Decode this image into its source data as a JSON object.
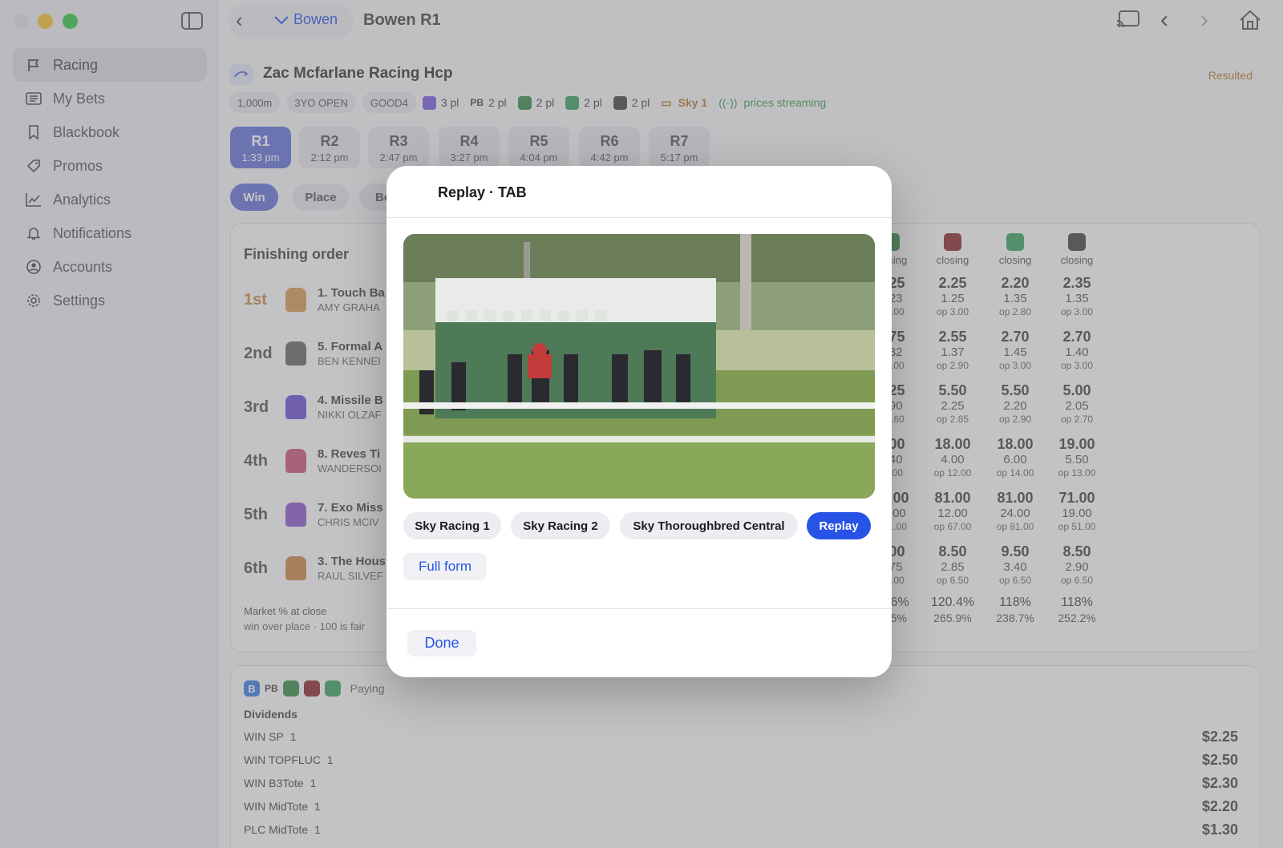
{
  "header": {
    "back_label": "Bowen",
    "title": "Bowen R1"
  },
  "sidebar": {
    "items": [
      {
        "label": "Racing",
        "icon": "flag-icon"
      },
      {
        "label": "My Bets",
        "icon": "list-icon"
      },
      {
        "label": "Blackbook",
        "icon": "bookmark-icon"
      },
      {
        "label": "Promos",
        "icon": "tag-icon"
      },
      {
        "label": "Analytics",
        "icon": "chart-icon"
      },
      {
        "label": "Notifications",
        "icon": "bell-icon"
      },
      {
        "label": "Accounts",
        "icon": "person-icon"
      },
      {
        "label": "Settings",
        "icon": "gear-icon"
      }
    ]
  },
  "race": {
    "name": "Zac Mcfarlane Racing Hcp",
    "status": "Resulted",
    "distance": "1,000m",
    "class": "3YO OPEN",
    "track": "GOOD4",
    "places": [
      "3 pl",
      "2 pl",
      "2 pl",
      "2 pl",
      "2 pl"
    ],
    "bookie_abbr": "PB",
    "channel": "Sky 1",
    "streaming": "prices streaming"
  },
  "race_tabs": [
    {
      "r": "R1",
      "t": "1:33 pm"
    },
    {
      "r": "R2",
      "t": "2:12 pm"
    },
    {
      "r": "R3",
      "t": "2:47 pm"
    },
    {
      "r": "R4",
      "t": "3:27 pm"
    },
    {
      "r": "R5",
      "t": "4:04 pm"
    },
    {
      "r": "R6",
      "t": "4:42 pm"
    },
    {
      "r": "R7",
      "t": "5:17 pm"
    }
  ],
  "bet_types": [
    "Win",
    "Place",
    "Bo"
  ],
  "finishing": {
    "title": "Finishing order",
    "rows": [
      {
        "pos": "1st",
        "name": "1. Touch Ba",
        "jockey": "AMY GRAHA",
        "silk": "#d89a52"
      },
      {
        "pos": "2nd",
        "name": "5. Formal A",
        "jockey": "BEN KENNEI",
        "silk": "#666666"
      },
      {
        "pos": "3rd",
        "name": "4. Missile B",
        "jockey": "NIKKI OLZAF",
        "silk": "#6b4fd1"
      },
      {
        "pos": "4th",
        "name": "8. Reves Ti",
        "jockey": "WANDERSOI",
        "silk": "#c8557a"
      },
      {
        "pos": "5th",
        "name": "7. Exo Miss",
        "jockey": "CHRIS MCIV",
        "silk": "#8a58c9"
      },
      {
        "pos": "6th",
        "name": "3. The Hous",
        "jockey": "RAUL SILVEF",
        "silk": "#c98846"
      }
    ],
    "market_title": "Market % at close",
    "market_sub": "win over place · 100 is fair"
  },
  "odds": {
    "header": "closing",
    "columns": [
      {
        "icon_color": "#3a8a4a",
        "icon": "shield-icon",
        "rows": [
          [
            "2.25",
            "1.23",
            "p 3.00"
          ],
          [
            "2.75",
            "1.32",
            "p 3.00"
          ],
          [
            "5.25",
            "1.90",
            "p 2.60"
          ],
          [
            "6.00",
            "4.40",
            "14.00"
          ],
          [
            "71.00",
            "13.00",
            "p 81.00"
          ],
          [
            "9.00",
            "2.75",
            "p 7.00"
          ]
        ],
        "market": [
          "18.6%",
          "76.5%"
        ]
      },
      {
        "icon_color": "#8a2a2a",
        "icon": "pb-icon",
        "rows": [
          [
            "2.25",
            "1.25",
            "op 3.00"
          ],
          [
            "2.55",
            "1.37",
            "op 2.90"
          ],
          [
            "5.50",
            "2.25",
            "op 2.85"
          ],
          [
            "18.00",
            "4.00",
            "op 12.00"
          ],
          [
            "81.00",
            "12.00",
            "op 67.00"
          ],
          [
            "8.50",
            "2.85",
            "op 6.50"
          ]
        ],
        "market": [
          "120.4%",
          "265.9%"
        ]
      },
      {
        "icon_color": "#3aa060",
        "icon": "tab-icon",
        "rows": [
          [
            "2.20",
            "1.35",
            "op 2.80"
          ],
          [
            "2.70",
            "1.45",
            "op 3.00"
          ],
          [
            "5.50",
            "2.20",
            "op 2.90"
          ],
          [
            "18.00",
            "6.00",
            "op 14.00"
          ],
          [
            "81.00",
            "24.00",
            "op 81.00"
          ],
          [
            "9.50",
            "3.40",
            "op 6.50"
          ]
        ],
        "market": [
          "118%",
          "238.7%"
        ]
      },
      {
        "icon_color": "#444444",
        "icon": "bookie-icon",
        "rows": [
          [
            "2.35",
            "1.35",
            "op 3.00"
          ],
          [
            "2.70",
            "1.40",
            "op 3.00"
          ],
          [
            "5.00",
            "2.05",
            "op 2.70"
          ],
          [
            "19.00",
            "5.50",
            "op 13.00"
          ],
          [
            "71.00",
            "19.00",
            "op 51.00"
          ],
          [
            "8.50",
            "2.90",
            "op 6.50"
          ]
        ],
        "market": [
          "118%",
          "252.2%"
        ]
      }
    ]
  },
  "dividends": {
    "paying": "Paying",
    "title": "Dividends",
    "rows": [
      {
        "label": "WIN SP",
        "n": "1",
        "amt": "$2.25"
      },
      {
        "label": "WIN TOPFLUC",
        "n": "1",
        "amt": "$2.50"
      },
      {
        "label": "WIN B3Tote",
        "n": "1",
        "amt": "$2.30"
      },
      {
        "label": "WIN MidTote",
        "n": "1",
        "amt": "$2.20"
      },
      {
        "label": "PLC MidTote",
        "n": "1",
        "amt": "$1.30"
      }
    ]
  },
  "modal": {
    "title": "Replay · TAB",
    "sources": [
      "Sky Racing 1",
      "Sky Racing 2",
      "Sky Thoroughbred Central",
      "Replay"
    ],
    "full_form": "Full form",
    "done": "Done"
  },
  "colors": {
    "accent": "#2753e6",
    "active_tab": "#6373d6",
    "resulted": "#b4782a",
    "streaming": "#3f9a4a"
  }
}
